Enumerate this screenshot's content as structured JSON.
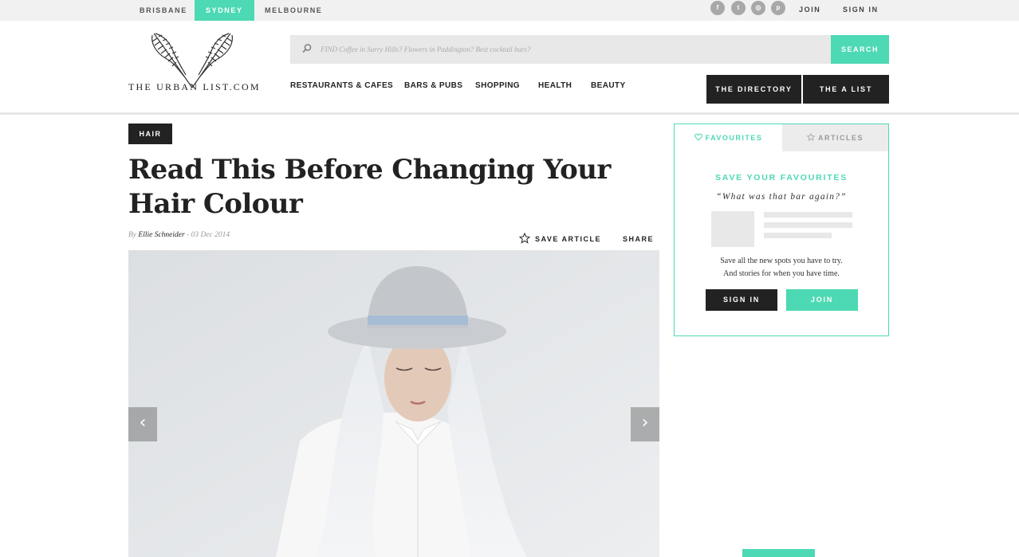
{
  "topbar": {
    "cities": [
      {
        "label": "BRISBANE",
        "active": false
      },
      {
        "label": "SYDNEY",
        "active": true
      },
      {
        "label": "MELBOURNE",
        "active": false
      }
    ],
    "social_icons": [
      "facebook-icon",
      "twitter-icon",
      "instagram-icon",
      "pinterest-icon"
    ],
    "social_glyphs": [
      "f",
      "t",
      "◎",
      "p"
    ],
    "join_label": "JOIN",
    "signin_label": "SIGN IN"
  },
  "header": {
    "logo_text": "THE URBAN LIST.COM",
    "search": {
      "placeholder": "FIND Coffee in Surry Hills? Flowers in Paddington? Best cocktail bars?",
      "button_label": "SEARCH"
    },
    "nav": [
      "RESTAURANTS & CAFES",
      "BARS & PUBS",
      "SHOPPING",
      "HEALTH",
      "BEAUTY"
    ],
    "directory_label": "THE DIRECTORY",
    "alist_label": "THE A LIST"
  },
  "article": {
    "tag": "HAIR",
    "title": "Read This Before Changing Your Hair Colour",
    "by": "By",
    "author": "Ellie Schneider",
    "date": " - 03 Dec 2014",
    "save_label": "SAVE ARTICLE",
    "share_label": "SHARE",
    "prev_arrow": "‹",
    "next_arrow": "›"
  },
  "widget": {
    "tab_favourites": "FAVOURITES",
    "tab_articles": "ARTICLES",
    "heading": "SAVE YOUR FAVOURITES",
    "quote": "“What was that bar again?”",
    "text_line1": "Save all the new spots you have to try.",
    "text_line2": "And stories for when you have time.",
    "signin_label": "SIGN IN",
    "join_label": "JOIN"
  },
  "colors": {
    "accent": "#4dd9b4",
    "dark": "#222222"
  }
}
